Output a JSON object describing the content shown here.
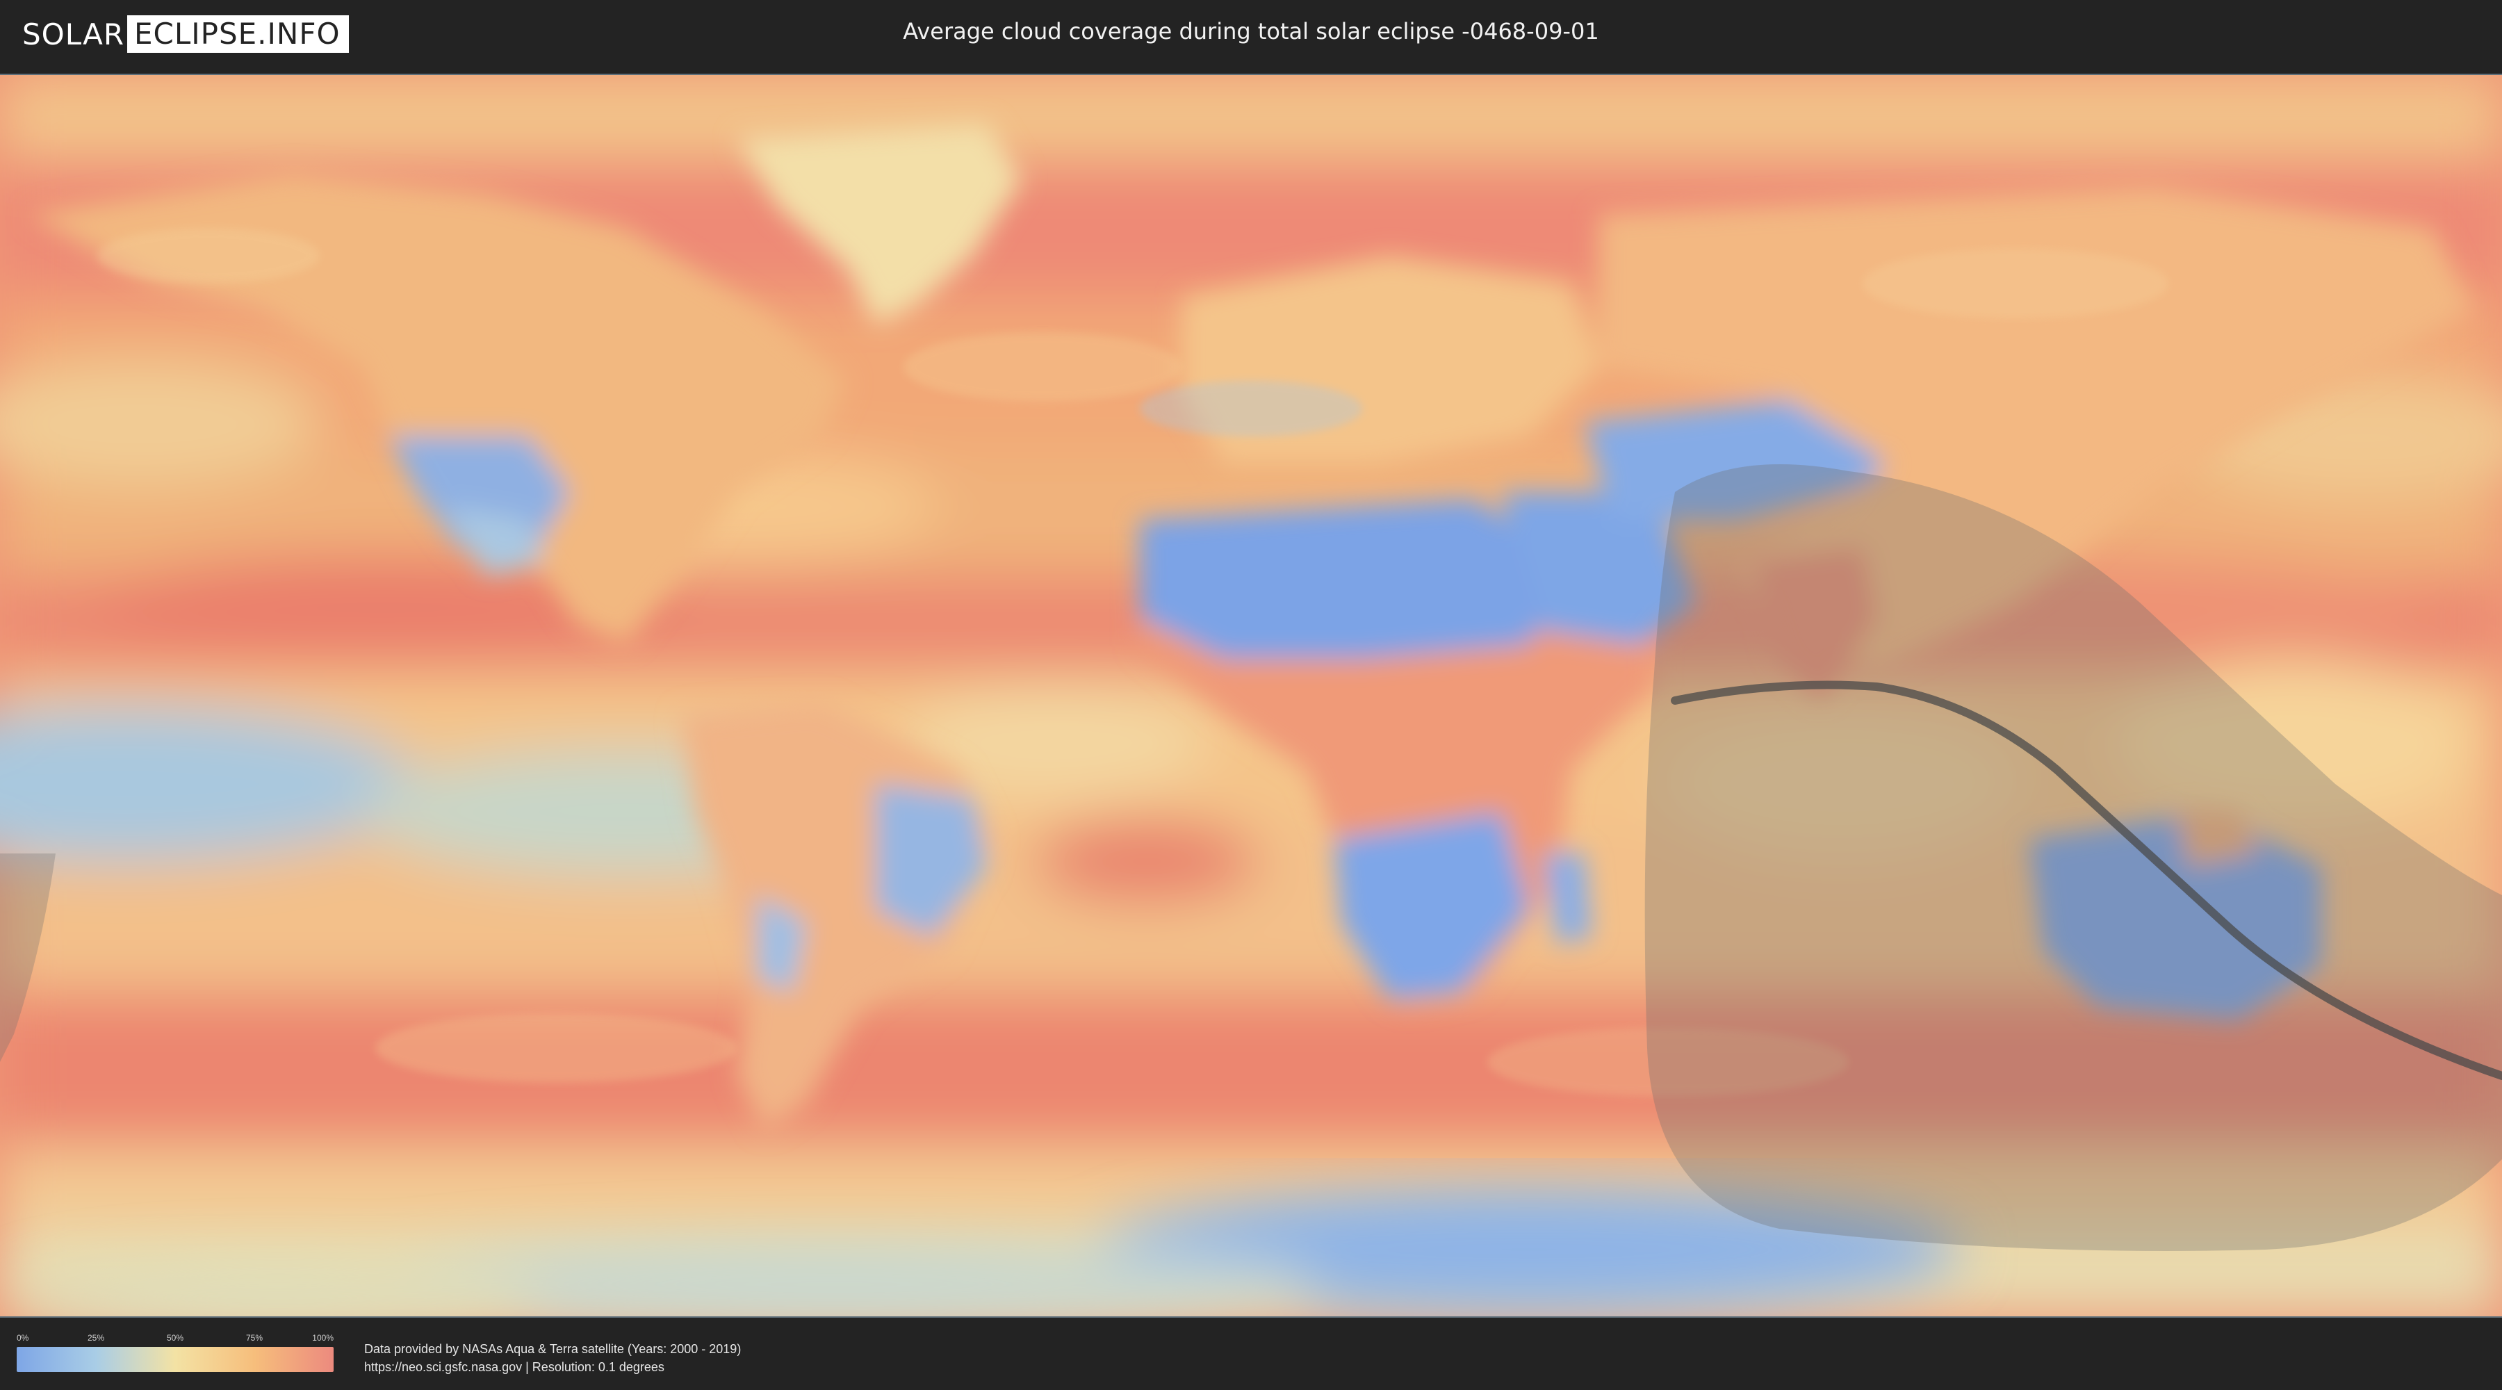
{
  "header": {
    "logo": {
      "part1": "SOLAR",
      "part2": "ECLIPSE.INFO"
    },
    "title": "Average cloud coverage during total solar eclipse -0468-09-01"
  },
  "legend": {
    "ticks": [
      "0%",
      "25%",
      "50%",
      "75%",
      "100%"
    ],
    "colors": [
      "#7ea6e6",
      "#a9cde6",
      "#f3e2a4",
      "#f6be7c",
      "#ec8a7e"
    ]
  },
  "footer": {
    "line1": "Data provided by NASAs Aqua & Terra satellite (Years: 2000 - 2019)",
    "line2": "https://neo.sci.gsfc.nasa.gov | Resolution: 0.1 degrees"
  },
  "map": {
    "projection": "equirectangular",
    "eclipse_path_color": "#4a4a4a",
    "shadow_zone_color": "#6d6d6d"
  }
}
